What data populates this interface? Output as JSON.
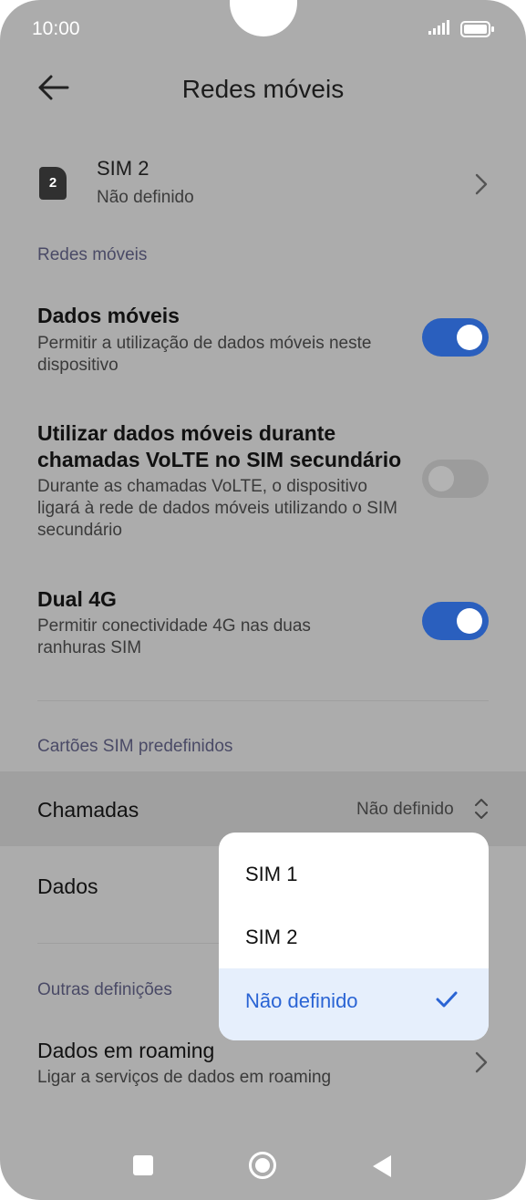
{
  "status_bar": {
    "time": "10:00"
  },
  "header": {
    "title": "Redes móveis"
  },
  "sim_item": {
    "badge": "2",
    "title": "SIM 2",
    "subtitle": "Não definido"
  },
  "sections": {
    "mobile_networks": "Redes móveis",
    "default_sims": "Cartões SIM predefinidos",
    "other_settings": "Outras definições"
  },
  "mobile_data": {
    "title": "Dados móveis",
    "subtitle": "Permitir a utilização de dados móveis neste dispositivo",
    "enabled": true
  },
  "volte_data": {
    "title": "Utilizar dados móveis durante chamadas VoLTE no SIM secundário",
    "subtitle": "Durante as chamadas VoLTE, o dispositivo ligará à rede de dados móveis utilizando o SIM secundário",
    "enabled": false
  },
  "dual_4g": {
    "title": "Dual 4G",
    "subtitle": "Permitir conectividade 4G nas duas ranhuras SIM",
    "enabled": true
  },
  "calls": {
    "title": "Chamadas",
    "value": "Não definido"
  },
  "data": {
    "title": "Dados"
  },
  "roaming": {
    "title": "Dados em roaming",
    "subtitle": "Ligar a serviços de dados em roaming"
  },
  "dropdown": {
    "options": [
      "SIM 1",
      "SIM 2",
      "Não definido"
    ],
    "selected": "Não definido"
  },
  "colors": {
    "accent": "#2a5fbe",
    "selected_text": "#2a64d4",
    "overlay_bg": "#acacac"
  }
}
